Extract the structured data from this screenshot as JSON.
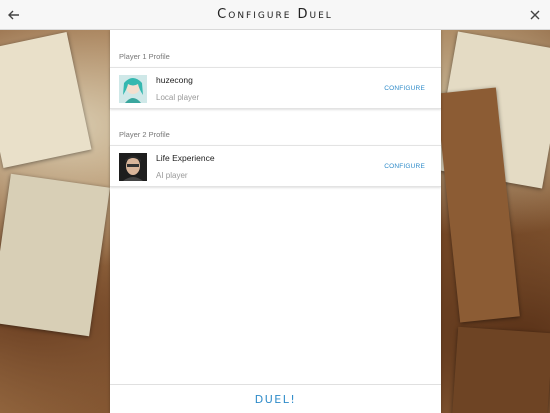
{
  "header": {
    "title": "Configure Duel"
  },
  "players": [
    {
      "section_label": "Player 1 Profile",
      "name": "huzecong",
      "role": "Local player",
      "configure_label": "CONFIGURE"
    },
    {
      "section_label": "Player 2 Profile",
      "name": "Life Experience",
      "role": "AI player",
      "configure_label": "CONFIGURE"
    }
  ],
  "actions": {
    "duel_label": "DUEL!"
  },
  "colors": {
    "accent": "#2e8bc9",
    "topbar": "#f7f7f7",
    "panel": "#ffffff"
  },
  "icons": {
    "back": "arrow-left-icon",
    "close": "close-icon"
  }
}
